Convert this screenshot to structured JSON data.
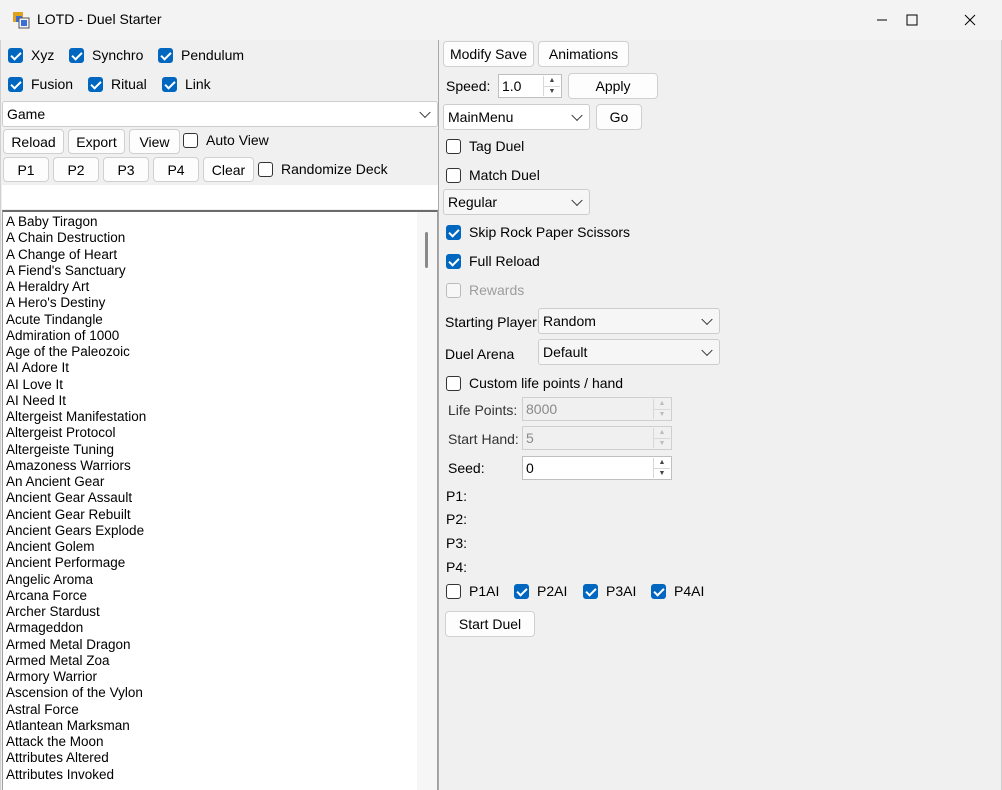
{
  "window": {
    "title": "LOTD - Duel Starter"
  },
  "card_filters": [
    {
      "label": "Xyz",
      "checked": true
    },
    {
      "label": "Synchro",
      "checked": true
    },
    {
      "label": "Pendulum",
      "checked": true
    },
    {
      "label": "Fusion",
      "checked": true
    },
    {
      "label": "Ritual",
      "checked": true
    },
    {
      "label": "Link",
      "checked": true
    }
  ],
  "source_select": {
    "value": "Game"
  },
  "deck_buttons": {
    "reload": "Reload",
    "export": "Export",
    "view": "View",
    "auto_view": "Auto View"
  },
  "player_buttons": {
    "p1": "P1",
    "p2": "P2",
    "p3": "P3",
    "p4": "P4",
    "clear": "Clear",
    "randomize": "Randomize Deck"
  },
  "deck_search": {
    "value": ""
  },
  "decks": [
    "A Baby Tiragon",
    "A Chain Destruction",
    "A Change of Heart",
    "A Fiend's Sanctuary",
    "A Heraldry Art",
    "A Hero's Destiny",
    "Acute Tindangle",
    "Admiration of 1000",
    "Age of the Paleozoic",
    "AI Adore It",
    "AI Love It",
    "AI Need It",
    "Altergeist Manifestation",
    "Altergeist Protocol",
    "Altergeiste Tuning",
    "Amazoness Warriors",
    "An Ancient Gear",
    "Ancient Gear Assault",
    "Ancient Gear Rebuilt",
    "Ancient Gears Explode",
    "Ancient Golem",
    "Ancient Performage",
    "Angelic Aroma",
    "Arcana Force",
    "Archer Stardust",
    "Armageddon",
    "Armed Metal Dragon",
    "Armed Metal Zoa",
    "Armory Warrior",
    "Ascension of the Vylon",
    "Astral Force",
    "Atlantean Marksman",
    "Attack the Moon",
    "Attributes Altered",
    "Attributes Invoked"
  ],
  "right": {
    "modify_save": "Modify Save",
    "animations": "Animations",
    "speed_label": "Speed:",
    "speed_value": "1.0",
    "apply": "Apply",
    "screen_select": "MainMenu",
    "go": "Go",
    "tag_duel": {
      "label": "Tag Duel",
      "checked": false
    },
    "match_duel": {
      "label": "Match Duel",
      "checked": false
    },
    "duel_type": "Regular",
    "skip_rps": {
      "label": "Skip Rock Paper Scissors",
      "checked": true
    },
    "full_reload": {
      "label": "Full Reload",
      "checked": true
    },
    "rewards": {
      "label": "Rewards",
      "checked": false
    },
    "starting_player_label": "Starting Player",
    "starting_player": "Random",
    "duel_arena_label": "Duel Arena",
    "duel_arena": "Default",
    "custom_lp": {
      "label": "Custom life points / hand",
      "checked": false
    },
    "life_points_label": "Life Points:",
    "life_points": "8000",
    "start_hand_label": "Start Hand:",
    "start_hand": "5",
    "seed_label": "Seed:",
    "seed": "0",
    "p1_label": "P1:",
    "p2_label": "P2:",
    "p3_label": "P3:",
    "p4_label": "P4:",
    "ai": [
      {
        "label": "P1AI",
        "checked": false
      },
      {
        "label": "P2AI",
        "checked": true
      },
      {
        "label": "P3AI",
        "checked": true
      },
      {
        "label": "P4AI",
        "checked": true
      }
    ],
    "start_duel": "Start Duel"
  }
}
